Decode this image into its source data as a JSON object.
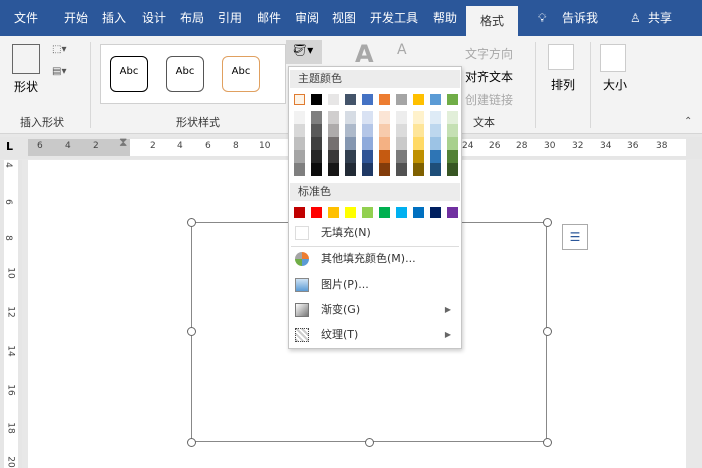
{
  "tabs": [
    "文件",
    "开始",
    "插入",
    "设计",
    "布局",
    "引用",
    "邮件",
    "审阅",
    "视图",
    "开发工具",
    "帮助",
    "格式"
  ],
  "tell_me": "告诉我",
  "share": "共享",
  "ribbon": {
    "shape_label": "形状",
    "insert_shapes_group": "插入形状",
    "styles_group": "形状样式",
    "style_sample": "Abc",
    "text_direction": "文字方向",
    "align_text": "对齐文本",
    "create_link": "创建链接",
    "text_group": "文本",
    "arrange": "排列",
    "size": "大小",
    "font_a": "A"
  },
  "ruler": {
    "left": [
      "6",
      "4",
      "2"
    ],
    "right": [
      "2",
      "4",
      "6",
      "8",
      "10",
      "24",
      "26",
      "28",
      "30",
      "32",
      "34",
      "36",
      "38"
    ],
    "vertical": [
      "4",
      "6",
      "8",
      "10",
      "12",
      "14",
      "16",
      "18",
      "20"
    ]
  },
  "menu": {
    "theme_header": "主题颜色",
    "theme_colors": [
      "#fdf3e6",
      "#000000",
      "#e7e6e6",
      "#44546a",
      "#4472c4",
      "#ed7d31",
      "#a5a5a5",
      "#ffc000",
      "#5b9bd5",
      "#70ad47"
    ],
    "shades": [
      [
        "#f2f2f2",
        "#7f7f7f",
        "#d0cece",
        "#d6dce4",
        "#d9e2f3",
        "#fbe5d5",
        "#ededed",
        "#fff2cc",
        "#deebf6",
        "#e2efd9"
      ],
      [
        "#d8d8d8",
        "#595959",
        "#aeabab",
        "#adb9ca",
        "#b4c6e7",
        "#f7cbac",
        "#dbdbdb",
        "#fee599",
        "#bdd7ee",
        "#c5e0b3"
      ],
      [
        "#bfbfbf",
        "#3f3f3f",
        "#757070",
        "#8496b0",
        "#8eaadb",
        "#f4b183",
        "#c9c9c9",
        "#ffd965",
        "#9cc3e5",
        "#a8d08d"
      ],
      [
        "#a5a5a5",
        "#262626",
        "#3a3838",
        "#323f4f",
        "#2f5496",
        "#c55a11",
        "#7b7b7b",
        "#bf9000",
        "#2e75b5",
        "#538135"
      ],
      [
        "#7f7f7f",
        "#0c0c0c",
        "#171616",
        "#222a35",
        "#1f3864",
        "#833c0b",
        "#525252",
        "#7f6000",
        "#1e4e79",
        "#375623"
      ]
    ],
    "standard_header": "标准色",
    "standard_colors": [
      "#c00000",
      "#ff0000",
      "#ffc000",
      "#ffff00",
      "#92d050",
      "#00b050",
      "#00b0f0",
      "#0070c0",
      "#002060",
      "#7030a0"
    ],
    "items": [
      "无填充(N)",
      "其他填充颜色(M)...",
      "图片(P)...",
      "渐变(G)",
      "纹理(T)"
    ]
  },
  "colors": {
    "accent": "#2b579a"
  }
}
